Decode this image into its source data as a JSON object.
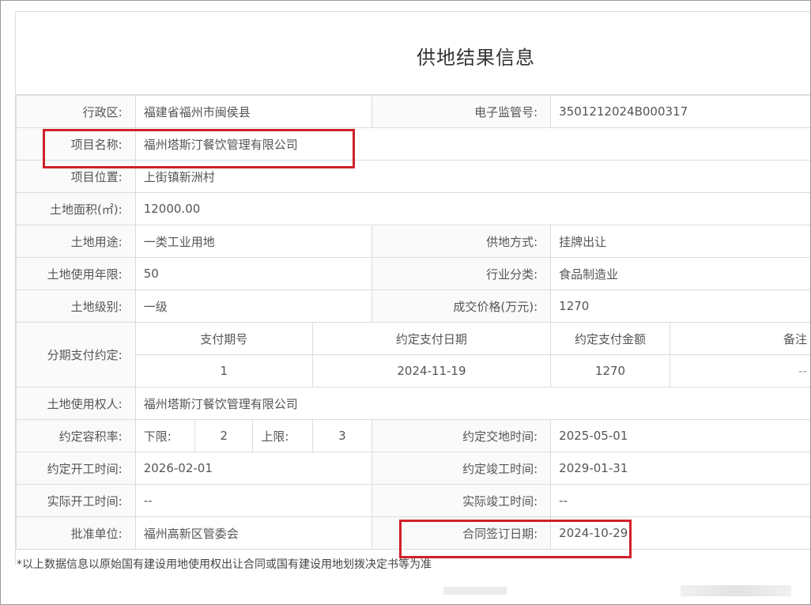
{
  "title": "供地结果信息",
  "rows": {
    "district_label": "行政区:",
    "district_value": "福建省福州市闽侯县",
    "supervision_label": "电子监管号:",
    "supervision_value": "3501212024B000317",
    "project_name_label": "项目名称:",
    "project_name_value": "福州塔斯汀餐饮管理有限公司",
    "project_location_label": "项目位置:",
    "project_location_value": "上街镇新洲村",
    "land_area_label": "土地面积(㎡):",
    "land_area_value": "12000.00",
    "land_use_label": "土地用途:",
    "land_use_value": "一类工业用地",
    "supply_method_label": "供地方式:",
    "supply_method_value": "挂牌出让",
    "use_years_label": "土地使用年限:",
    "use_years_value": "50",
    "industry_label": "行业分类:",
    "industry_value": "食品制造业",
    "land_grade_label": "土地级别:",
    "land_grade_value": "一级",
    "price_label": "成交价格(万元):",
    "price_value": "1270",
    "installment_label": "分期支付约定:",
    "installment_headers": [
      "支付期号",
      "约定支付日期",
      "约定支付金额",
      "备注"
    ],
    "installment_row": [
      "1",
      "2024-11-19",
      "1270",
      "--"
    ],
    "land_user_label": "土地使用权人:",
    "land_user_value": "福州塔斯汀餐饮管理有限公司",
    "far_label": "约定容积率:",
    "far_lower_label": "下限:",
    "far_lower_value": "2",
    "far_upper_label": "上限:",
    "far_upper_value": "3",
    "handover_label": "约定交地时间:",
    "handover_value": "2025-05-01",
    "start_plan_label": "约定开工时间:",
    "start_plan_value": "2026-02-01",
    "finish_plan_label": "约定竣工时间:",
    "finish_plan_value": "2029-01-31",
    "start_actual_label": "实际开工时间:",
    "start_actual_value": "--",
    "finish_actual_label": "实际竣工时间:",
    "finish_actual_value": "--",
    "approver_label": "批准单位:",
    "approver_value": "福州高新区管委会",
    "contract_date_label": "合同签订日期:",
    "contract_date_value": "2024-10-29"
  },
  "footnote": "*以上数据信息以原始国有建设用地使用权出让合同或国有建设用地划拨决定书等为准",
  "colors": {
    "highlight": "#d0202a",
    "border": "#dcdcdc"
  }
}
